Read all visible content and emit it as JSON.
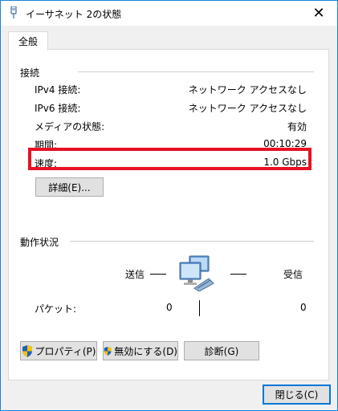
{
  "window": {
    "title": "イーサネット 2の状態",
    "close": "✕"
  },
  "tab": {
    "label": "全般"
  },
  "connection": {
    "header": "接続",
    "rows": [
      {
        "label": "IPv4 接続:",
        "value": "ネットワーク アクセスなし"
      },
      {
        "label": "IPv6 接続:",
        "value": "ネットワーク アクセスなし"
      },
      {
        "label": "メディアの状態:",
        "value": "有効"
      },
      {
        "label": "期間:",
        "value": "00:10:29"
      },
      {
        "label": "速度:",
        "value": "1.0 Gbps"
      }
    ],
    "details_button": "詳細(E)..."
  },
  "activity": {
    "header": "動作状況",
    "sent_label": "送信",
    "received_label": "受信",
    "packets_label": "パケット:",
    "packets_sent": "0",
    "packets_received": "0",
    "icon": "network-computers-icon"
  },
  "buttons": {
    "properties": "プロパティ(P)",
    "disable": "無効にする(D)",
    "diagnose": "診断(G)",
    "close": "閉じる(C)"
  },
  "colors": {
    "highlight": "#e81123",
    "accent": "#0078d7",
    "shield_blue": "#1f5fbf",
    "shield_yellow": "#f5c400"
  }
}
